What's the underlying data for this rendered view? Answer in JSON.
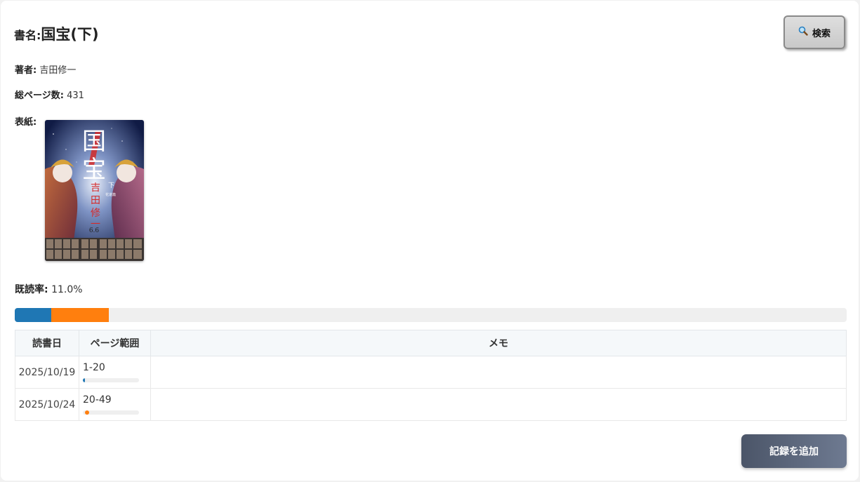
{
  "book": {
    "title_label": "書名:",
    "title": "国宝(下)",
    "author_label": "著者:",
    "author": "吉田修一",
    "pages_label": "総ページ数:",
    "total_pages": "431",
    "cover_label": "表紙:",
    "cover_text": {
      "title_big_1": "国",
      "title_big_2": "宝",
      "volume": "下",
      "subtitle": "花道篇",
      "author_vertical_1": "吉",
      "author_vertical_2": "田",
      "author_vertical_3": "修",
      "author_vertical_4": "一",
      "date": "6.6"
    }
  },
  "progress": {
    "label": "既読率:",
    "value_text": "11.0%",
    "segments": [
      {
        "from_page": 1,
        "to_page": 20,
        "color": "#1f77b4"
      },
      {
        "from_page": 20,
        "to_page": 49,
        "color": "#ff7f0e"
      }
    ]
  },
  "log_table": {
    "headers": [
      "読書日",
      "ページ範囲",
      "メモ"
    ],
    "rows": [
      {
        "date": "2025/10/19",
        "range": "1-20",
        "memo": "",
        "color": "#1f77b4"
      },
      {
        "date": "2025/10/24",
        "range": "20-49",
        "memo": "",
        "color": "#ff7f0e"
      }
    ]
  },
  "buttons": {
    "search_icon": "magnifier-icon",
    "search_label": "検索",
    "add_record_label": "記録を追加"
  }
}
